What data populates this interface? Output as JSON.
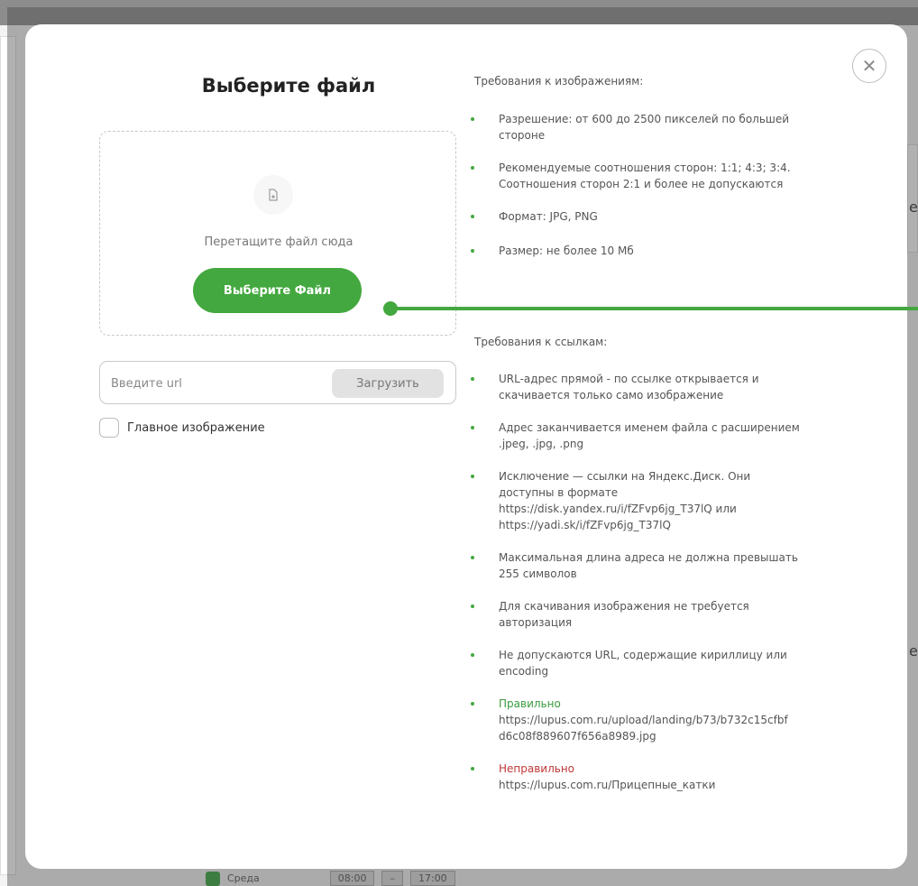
{
  "background": {
    "bottom_row": {
      "day": "Среда",
      "time_from": "08:00",
      "separator": "–",
      "time_to": "17:00"
    },
    "fragments": [
      "е",
      "е"
    ]
  },
  "modal": {
    "title": "Выберите файл",
    "close_icon": "close-icon",
    "dropzone": {
      "icon": "file-icon",
      "hint": "Перетащите файл сюда",
      "button_label": "Выберите Файл"
    },
    "url": {
      "placeholder": "Введите url",
      "button_label": "Загрузить"
    },
    "main_image_label": "Главное изображение",
    "image_requirements": {
      "heading": "Требования к изображениям:",
      "items": [
        [
          "Разрешение: от 600 до 2500 пикселей по большей",
          "стороне"
        ],
        [
          "Рекомендуемые соотношения сторон: 1:1; 4:3; 3:4.",
          "Соотношения сторон 2:1 и более не допускаются"
        ],
        [
          "Формат: JPG, PNG"
        ],
        [
          "Размер: не более 10 Мб"
        ]
      ]
    },
    "link_requirements": {
      "heading": "Требования к ссылкам:",
      "items": [
        [
          "URL-адрес прямой - по ссылке открывается и",
          "скачивается только само изображение"
        ],
        [
          "Адрес заканчивается именем файла с расширением",
          ".jpeg, .jpg, .png"
        ],
        [
          "Исключение — ссылки на Яндекс.Диск. Они",
          "доступны в формате",
          "https://disk.yandex.ru/i/fZFvp6jg_T37lQ или",
          "https://yadi.sk/i/fZFvp6jg_T37lQ"
        ],
        [
          "Максимальная длина адреса не должна превышать",
          "255 символов"
        ],
        [
          "Для скачивания изображения не требуется",
          "авторизация"
        ],
        [
          "Не допускаются URL, содержащие кириллицу или",
          "encoding"
        ]
      ],
      "correct": {
        "label": "Правильно",
        "lines": [
          "https://lupus.com.ru/upload/landing/b73/b732c15cfbf",
          "d6c08f889607f656a8989.jpg"
        ]
      },
      "incorrect": {
        "label": "Неправильно",
        "lines": [
          "https://lupus.com.ru/Прицепные_катки"
        ]
      }
    }
  },
  "colors": {
    "accent": "#43a83f",
    "error": "#c03838",
    "overlay": "rgba(70,70,70,0.42)"
  }
}
